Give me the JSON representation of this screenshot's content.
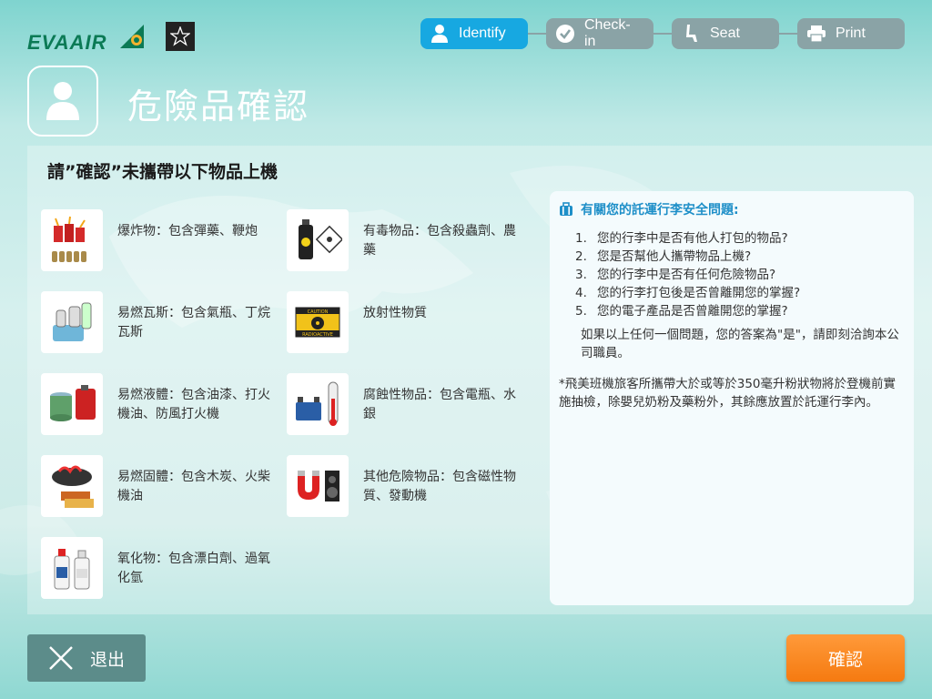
{
  "brand": {
    "airline_name": "EVAAIR",
    "alliance_icon": "star-alliance-icon"
  },
  "steps": [
    {
      "label": "Identify",
      "icon": "user-icon",
      "active": true
    },
    {
      "label": "Check-in",
      "icon": "check-circle-icon",
      "active": false
    },
    {
      "label": "Seat",
      "icon": "seat-icon",
      "active": false
    },
    {
      "label": "Print",
      "icon": "printer-icon",
      "active": false
    }
  ],
  "page": {
    "title": "危險品確認",
    "title_icon": "user-icon"
  },
  "panel": {
    "heading": "請”確認”未攜帶以下物品上機",
    "items": [
      {
        "text": "爆炸物：包含彈藥、鞭炮",
        "icon": "explosives-icon"
      },
      {
        "text": "有毒物品：包含殺蟲劑、農藥",
        "icon": "toxic-icon"
      },
      {
        "text": "易燃瓦斯：包含氣瓶、丁烷瓦斯",
        "icon": "flammable-gas-icon"
      },
      {
        "text": "放射性物質",
        "icon": "radioactive-icon"
      },
      {
        "text": "易燃液體：包含油漆、打火機油、防風打火機",
        "icon": "flammable-liquid-icon"
      },
      {
        "text": "腐蝕性物品：包含電瓶、水銀",
        "icon": "corrosive-icon"
      },
      {
        "text": "易燃固體：包含木炭、火柴機油",
        "icon": "flammable-solid-icon"
      },
      {
        "text": "其他危險物品：包含磁性物質、發動機",
        "icon": "magnet-icon"
      },
      {
        "text": "氧化物：包含漂白劑、過氧化氫",
        "icon": "oxidizer-icon"
      }
    ],
    "radioactive_label": {
      "top": "CAUTION",
      "bottom": "RADIOACTIVE"
    }
  },
  "info": {
    "heading": "有關您的託運行李安全問題:",
    "questions": [
      "您的行李中是否有他人打包的物品?",
      "您是否幫他人攜帶物品上機?",
      "您的行李中是否有任何危險物品?",
      "您的行李打包後是否曾離開您的掌握?",
      "您的電子產品是否曾離開您的掌握?"
    ],
    "advice": "如果以上任何一個問題，您的答案為\"是\"，請即刻洽詢本公司職員。",
    "note": "*飛美班機旅客所攜帶大於或等於350毫升粉狀物將於登機前實施抽檢，除嬰兒奶粉及藥粉外，其餘應放置於託運行李內。"
  },
  "buttons": {
    "exit_label": "退出",
    "confirm_label": "確認"
  },
  "colors": {
    "active_step": "#17a8e1",
    "inactive_step": "#8aa3a6",
    "confirm": "#f57a10",
    "exit": "#5c8c8a"
  }
}
